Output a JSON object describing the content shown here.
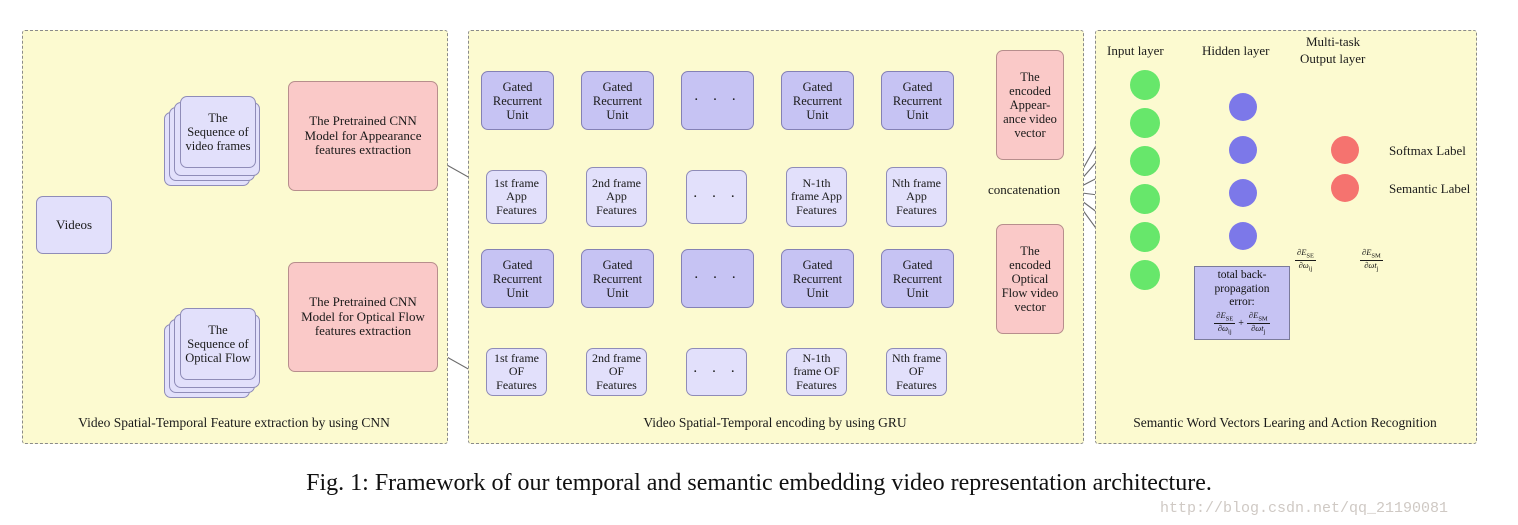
{
  "figure": {
    "caption": "Fig. 1: Framework of our temporal and semantic embedding video representation architecture.",
    "watermark": "http://blog.csdn.net/qq_21190081"
  },
  "colors": {
    "panel_bg": "#fcfad0",
    "panel_border": "#8a8a8a",
    "box_blue": "#c6c3f3",
    "box_light_blue": "#e2e0fb",
    "box_pink": "#fac9c8",
    "node_input": "#67e76b",
    "node_hidden": "#7c78e9",
    "node_output": "#f5736f",
    "wire": "#6b6b6b"
  },
  "panel_cnn": {
    "caption": "Video Spatial-Temporal Feature extraction by using CNN",
    "videos": "Videos",
    "seq_frames": "The Sequence of video frames",
    "seq_optical": "The Sequence of Optical Flow",
    "cnn_appearance": "The Pretrained CNN Model for Appearance features extraction",
    "cnn_optical": "The Pretrained CNN Model for Optical Flow features extraction"
  },
  "panel_gru": {
    "caption": "Video Spatial-Temporal encoding by using GRU",
    "gru_label": "Gated Recurrent Unit",
    "ellipsis": "· · ·",
    "app_features": [
      "1st frame App Features",
      "2nd frame App Features",
      "· · ·",
      "N-1th frame App Features",
      "Nth frame App Features"
    ],
    "of_features": [
      "1st frame OF Features",
      "2nd frame OF Features",
      "· · ·",
      "N-1th frame OF Features",
      "Nth frame OF Features"
    ],
    "encoded_appearance": "The encoded Appear- ance video vector",
    "encoded_optical": "The encoded Optical Flow video vector",
    "concatenation": "concatenation"
  },
  "panel_nn": {
    "caption": "Semantic Word Vectors Learing and Action Recognition",
    "input_layer_label": "Input layer",
    "hidden_layer_label": "Hidden layer",
    "output_layer_label_line1": "Multi-task",
    "output_layer_label_line2": "Output layer",
    "softmax_label": "Softmax Label",
    "semantic_label": "Semantic Label",
    "input_node_count": 6,
    "hidden_node_count": 4,
    "output_node_count": 2,
    "grad_softmax_num": "∂E",
    "grad_softmax_num_sub": "SE",
    "grad_softmax_den": "∂ω",
    "grad_softmax_den_sub": "ij",
    "grad_semantic_num": "∂E",
    "grad_semantic_num_sub": "SM",
    "grad_semantic_den": "∂ωt",
    "grad_semantic_den_sub": "j",
    "backprop_line1": "total back-",
    "backprop_line2": "propagation",
    "backprop_line3": "error:",
    "backprop_plus": "+"
  }
}
